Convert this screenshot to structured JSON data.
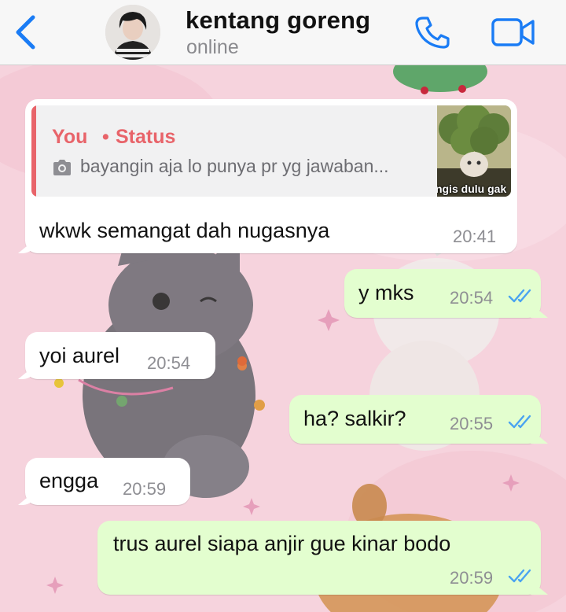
{
  "header": {
    "contact_name": "kentang goreng",
    "status": "online",
    "accent_color": "#1a7cf5"
  },
  "icons": {
    "back": "chevron-left-icon",
    "call": "phone-icon",
    "video": "video-camera-icon",
    "camera": "camera-icon",
    "read_receipt": "double-check-icon"
  },
  "reply": {
    "author": "You",
    "separator": "•",
    "kind": "Status",
    "text": "bayangin aja lo punya pr yg jawaban...",
    "thumb_caption": "ngis dulu gak"
  },
  "messages": [
    {
      "text": "wkwk semangat dah nugasnya",
      "time": "20:41",
      "direction": "in"
    },
    {
      "text": "y mks",
      "time": "20:54",
      "direction": "out",
      "read": true
    },
    {
      "text": "yoi aurel",
      "time": "20:54",
      "direction": "in"
    },
    {
      "text": "ha? salkir?",
      "time": "20:55",
      "direction": "out",
      "read": true
    },
    {
      "text": "engga",
      "time": "20:59",
      "direction": "in"
    },
    {
      "text": "trus aurel siapa anjir gue kinar bodo",
      "time": "20:59",
      "direction": "out",
      "read": true
    }
  ],
  "colors": {
    "incoming_bubble": "#ffffff",
    "outgoing_bubble": "#e3fecf",
    "reply_accent": "#e8646a",
    "tick_blue": "#4aa3f0"
  }
}
